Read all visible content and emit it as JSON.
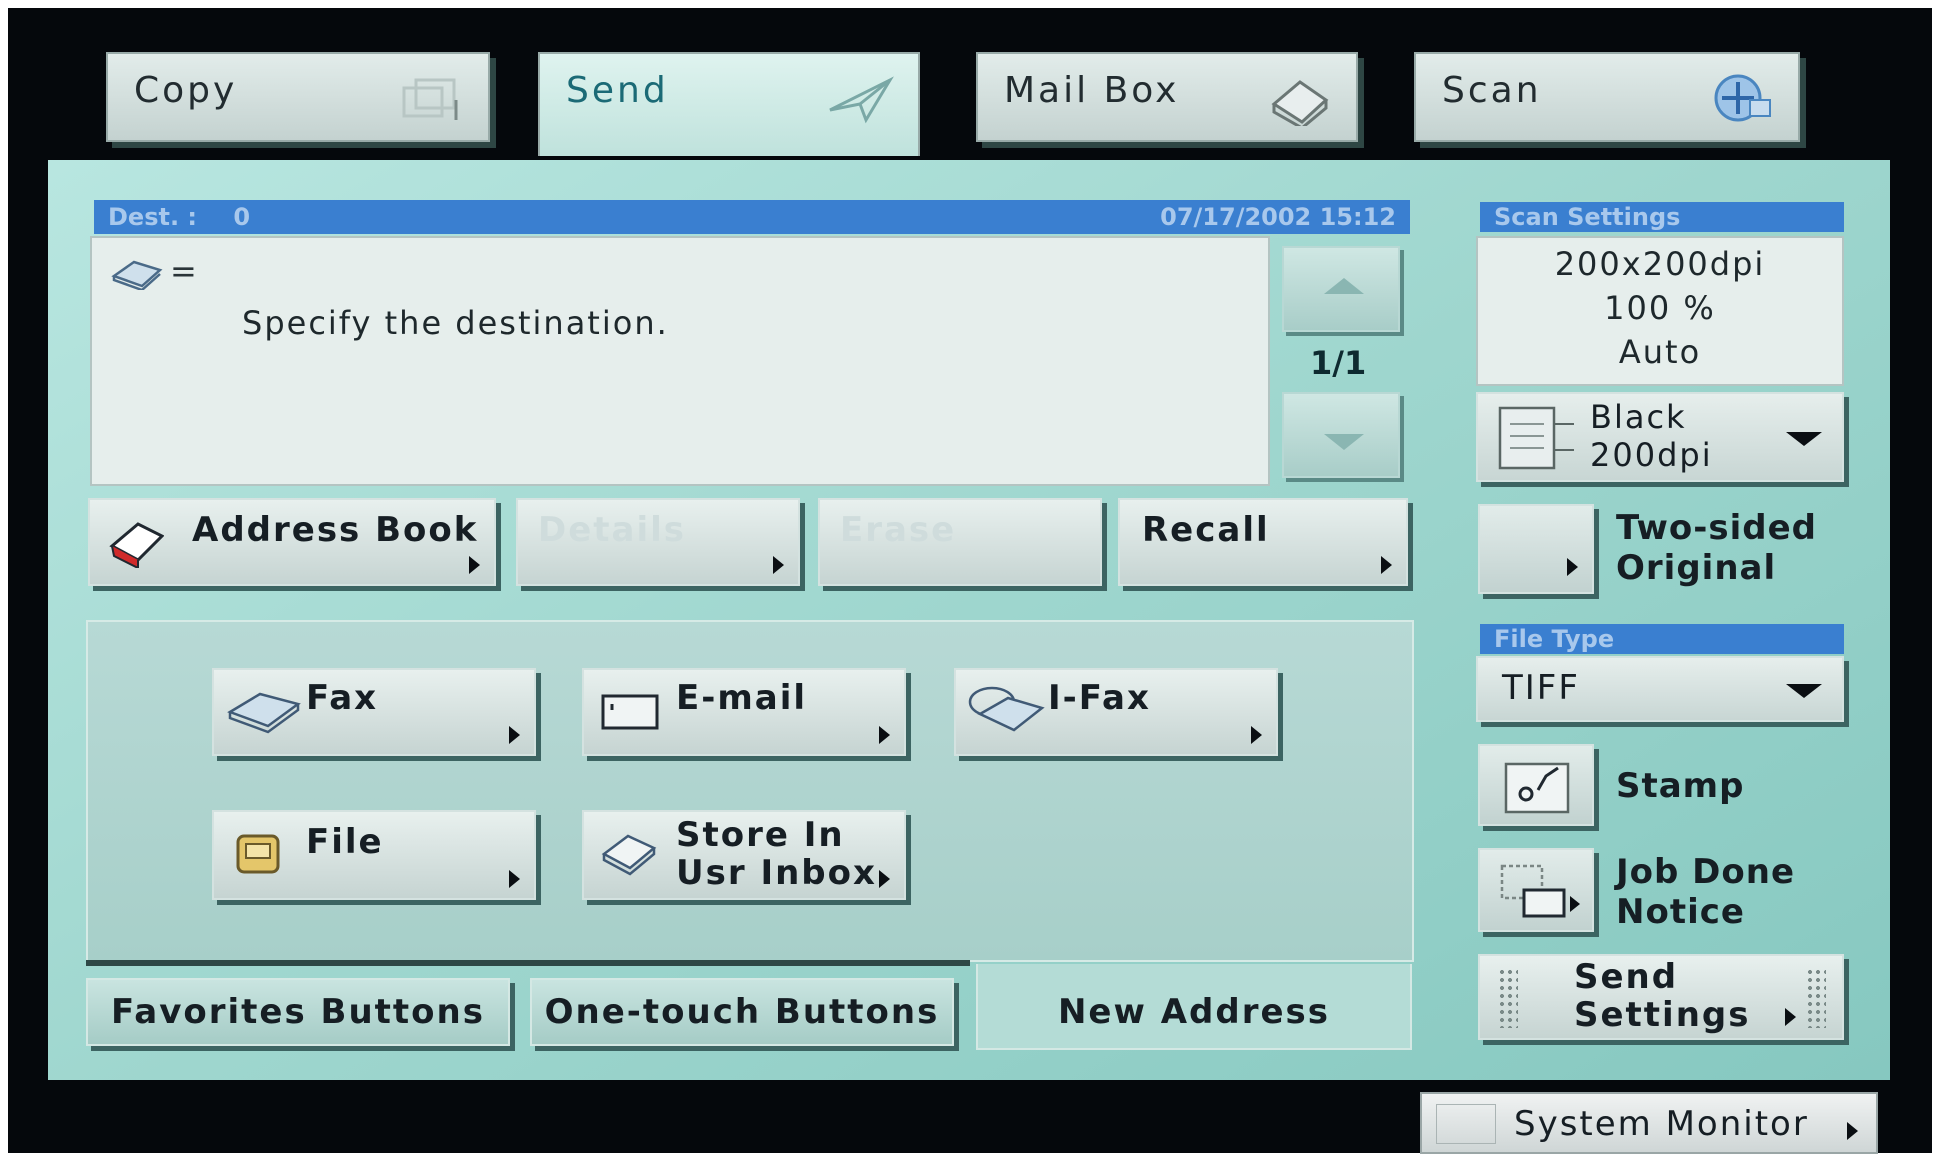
{
  "tabs": [
    {
      "label": "Copy",
      "icon": "copy-icon"
    },
    {
      "label": "Send",
      "icon": "send-icon",
      "active": true
    },
    {
      "label": "Mail Box",
      "icon": "mailbox-icon"
    },
    {
      "label": "Scan",
      "icon": "scan-icon"
    }
  ],
  "destination": {
    "header_label": "Dest. :",
    "count": "0",
    "datetime": "07/17/2002  15:12",
    "equals": "=",
    "message": "Specify the destination.",
    "page_indicator": "1/1"
  },
  "actions": {
    "address_book": "Address Book",
    "details": "Details",
    "erase": "Erase",
    "recall": "Recall"
  },
  "send_types": {
    "fax": "Fax",
    "email": "E-mail",
    "ifax": "I-Fax",
    "file": "File",
    "store_line1": "Store In",
    "store_line2": "Usr Inbox"
  },
  "bottom_tabs": {
    "favorites": "Favorites Buttons",
    "one_touch": "One-touch Buttons",
    "new_address": "New Address"
  },
  "scan_settings": {
    "header": "Scan Settings",
    "resolution": "200x200dpi",
    "ratio": "100 %",
    "size": "Auto",
    "mode_line1": "Black",
    "mode_line2": "200dpi"
  },
  "two_sided": {
    "line1": "Two-sided",
    "line2": "Original"
  },
  "file_type": {
    "header": "File Type",
    "value": "TIFF"
  },
  "stamp": "Stamp",
  "job_done": {
    "line1": "Job Done",
    "line2": "Notice"
  },
  "send_settings": {
    "line1": "Send",
    "line2": "Settings"
  },
  "system_monitor": "System Monitor",
  "colors": {
    "accent_blue": "#3a7fd0",
    "panel_teal": "#a8d8d0",
    "active_tab_text": "#1b6a76"
  }
}
